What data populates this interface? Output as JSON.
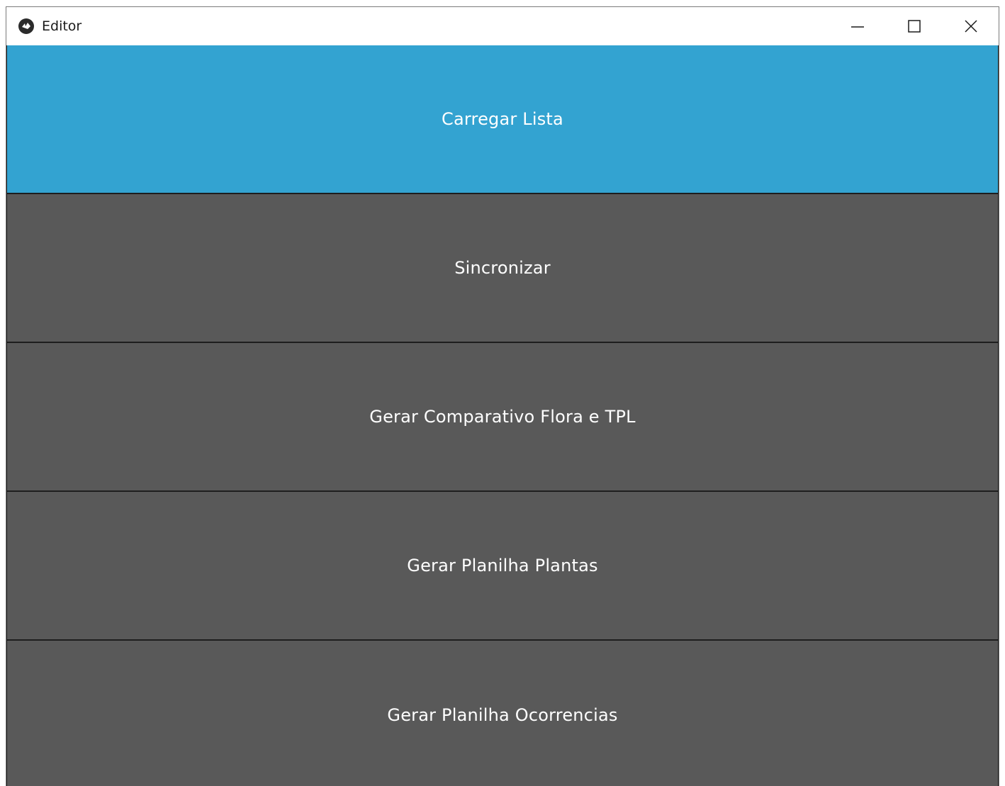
{
  "window": {
    "title": "Editor",
    "app_icon": "kivy-logo-icon",
    "controls": {
      "minimize_icon": "minimize-icon",
      "maximize_icon": "maximize-icon",
      "close_icon": "close-icon"
    }
  },
  "colors": {
    "active_button": "#33a3d1",
    "button": "#595959",
    "button_text": "#ffffff",
    "separator": "#1e1e1e"
  },
  "buttons": [
    {
      "label": "Carregar Lista",
      "state": "active"
    },
    {
      "label": "Sincronizar",
      "state": "normal"
    },
    {
      "label": "Gerar Comparativo Flora e TPL",
      "state": "normal"
    },
    {
      "label": "Gerar Planilha Plantas",
      "state": "normal"
    },
    {
      "label": "Gerar Planilha Ocorrencias",
      "state": "normal"
    }
  ]
}
